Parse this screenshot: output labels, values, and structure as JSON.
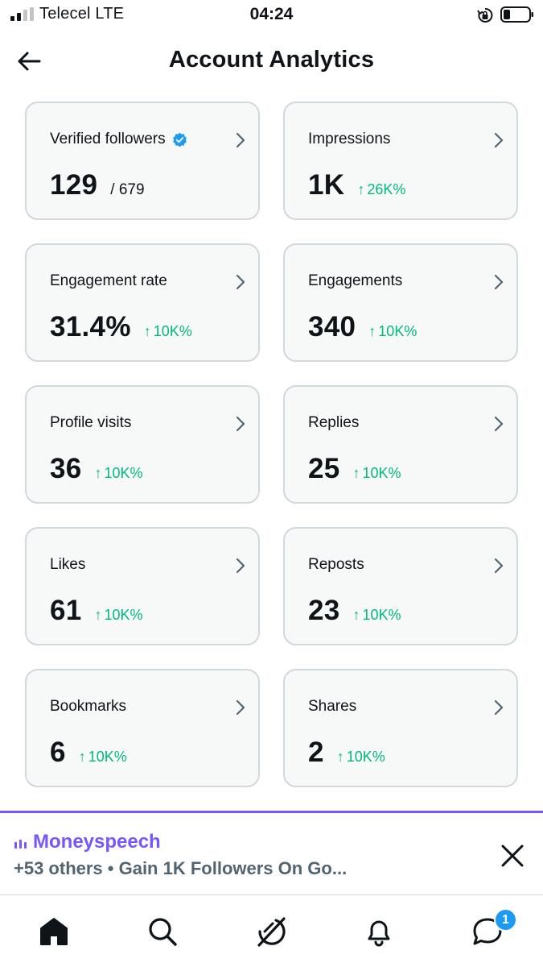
{
  "status_bar": {
    "carrier": "Telecel  LTE",
    "time": "04:24"
  },
  "header": {
    "title": "Account Analytics",
    "back_icon": "arrow-left-icon"
  },
  "colors": {
    "accent": "#1d9bf0",
    "positive": "#00ba7c",
    "purple": "#7856ff",
    "card_bg": "#f7f9f9",
    "card_border": "#cfd9de"
  },
  "cards": [
    {
      "label": "Verified followers",
      "value": "129",
      "total": "/ 679",
      "change": "",
      "verified": true
    },
    {
      "label": "Impressions",
      "value": "1K",
      "change": "26K%"
    },
    {
      "label": "Engagement rate",
      "value": "31.4%",
      "change": "10K%"
    },
    {
      "label": "Engagements",
      "value": "340",
      "change": "10K%"
    },
    {
      "label": "Profile visits",
      "value": "36",
      "change": "10K%"
    },
    {
      "label": "Replies",
      "value": "25",
      "change": "10K%"
    },
    {
      "label": "Likes",
      "value": "61",
      "change": "10K%"
    },
    {
      "label": "Reposts",
      "value": "23",
      "change": "10K%"
    },
    {
      "label": "Bookmarks",
      "value": "6",
      "change": "10K%"
    },
    {
      "label": "Shares",
      "value": "2",
      "change": "10K%"
    }
  ],
  "up_arrow": "↑",
  "notification": {
    "name": "Moneyspeech",
    "text": "+53 others • Gain 1K Followers On Go..."
  },
  "bottom_nav": {
    "items": [
      "home-icon",
      "search-icon",
      "grok-icon",
      "notifications-icon",
      "messages-icon"
    ],
    "messages_badge": "1"
  }
}
